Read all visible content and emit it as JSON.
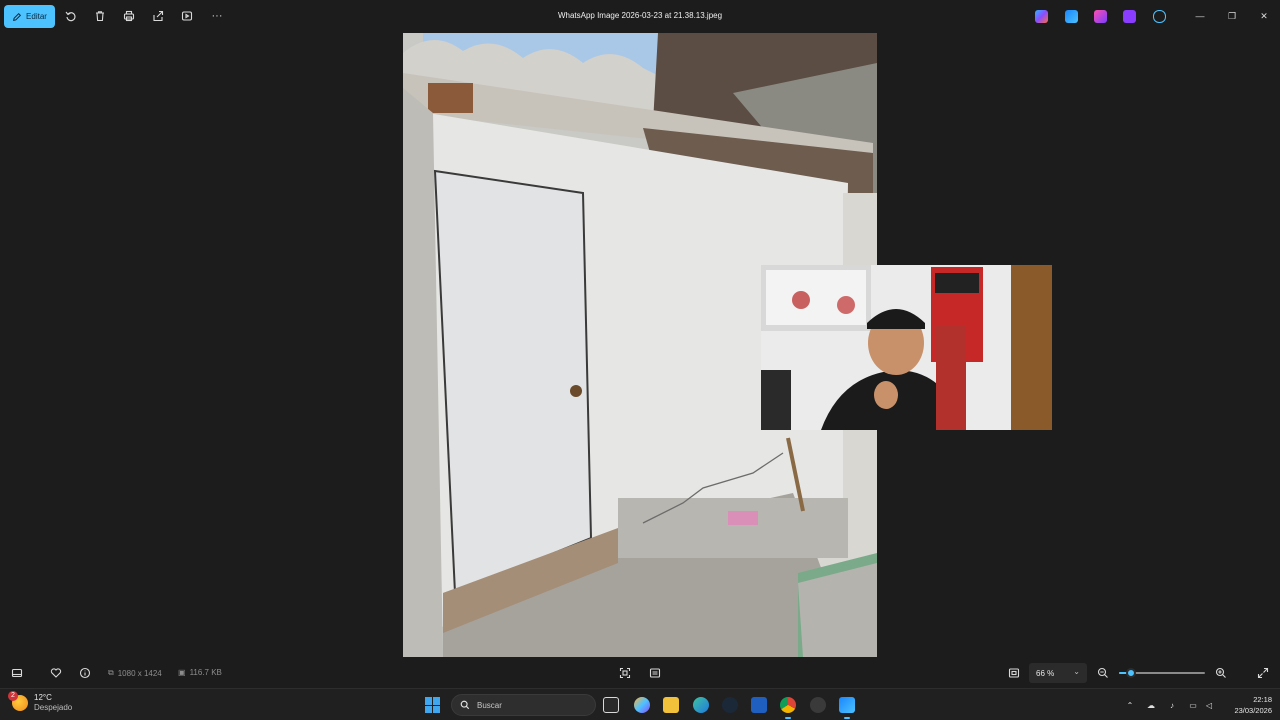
{
  "toolbar": {
    "edit_label": "Editar",
    "title": "WhatsApp Image 2026-03-23 at 21.38.13.jpeg",
    "icons": [
      "edit-icon",
      "rotate-icon",
      "delete-icon",
      "print-icon",
      "share-icon",
      "slideshow-icon",
      "more-icon"
    ],
    "more_glyph": "···",
    "app_icons": [
      "copilot-icon",
      "designer-icon",
      "clipchamp-icon",
      "clipchamp-purple-icon",
      "onedrive-icon"
    ],
    "window_controls": {
      "minimize": "—",
      "restore": "❐",
      "close": "✕"
    }
  },
  "viewer": {
    "dimensions": "1080 x 1424",
    "file_size": "116.7 KB",
    "zoom_value": "66 %",
    "zoom_fraction": 0.14
  },
  "taskbar": {
    "weather_temp": "12°C",
    "weather_desc": "Despejado",
    "weather_badge": "2",
    "search_placeholder": "Buscar",
    "time": "22:18",
    "date": "23/03/2026"
  },
  "colors": {
    "accent": "#4cc2ff",
    "background": "#1c1c1c",
    "taskbar": "#202020"
  }
}
